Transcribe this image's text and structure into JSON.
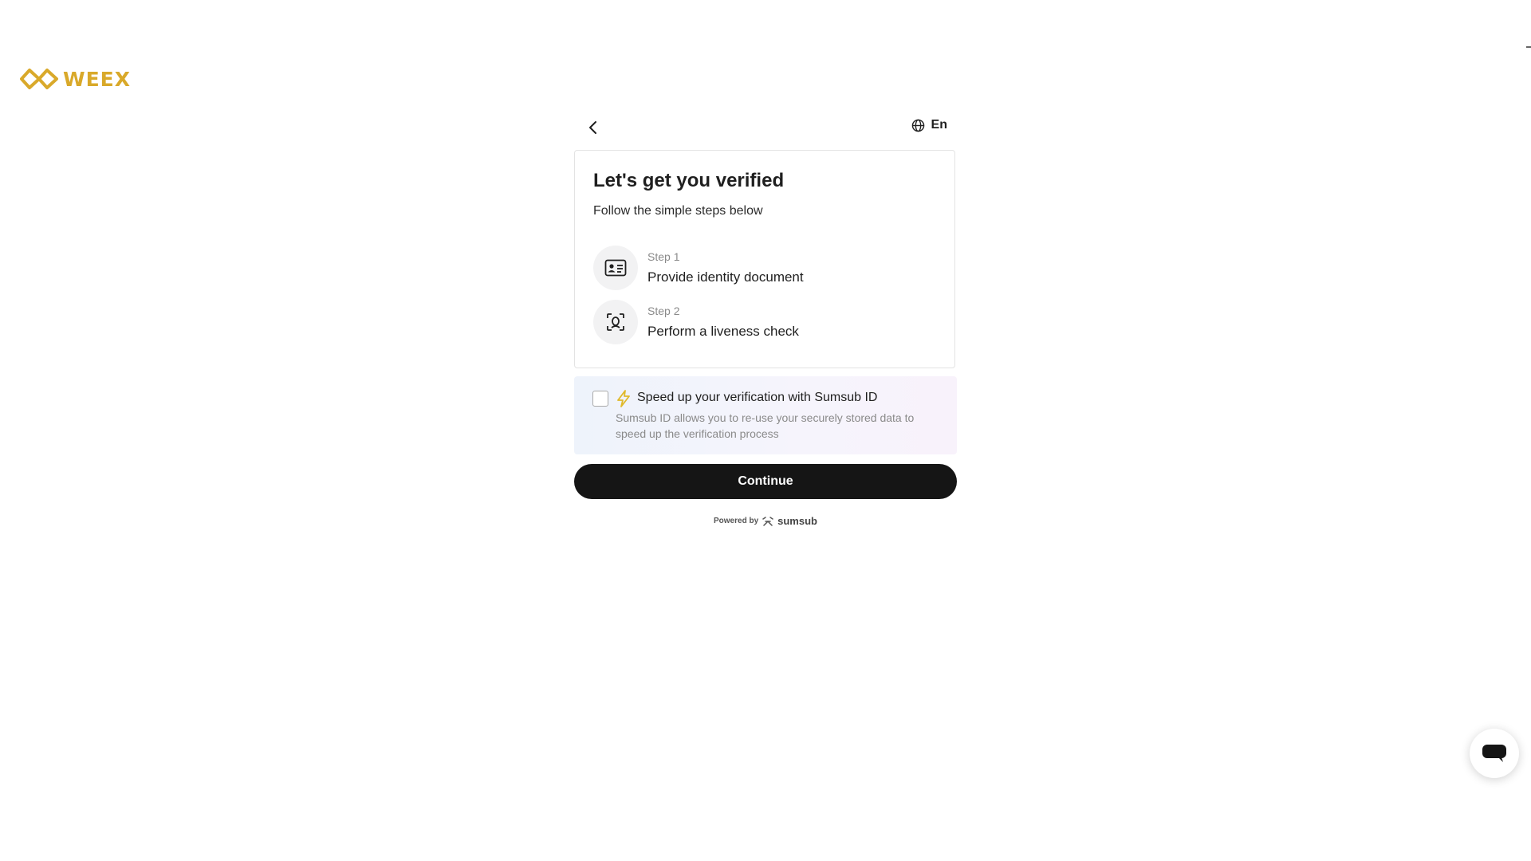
{
  "brand": {
    "logo_text": "WEEX",
    "logo_color": "#d9a92a"
  },
  "top_bar": {
    "back_icon": "chevron-left-icon",
    "language_icon": "globe-icon",
    "language_label": "En"
  },
  "card": {
    "title": "Let's get you verified",
    "subtitle": "Follow the simple steps below",
    "steps": [
      {
        "label": "Step 1",
        "text": "Provide identity document",
        "icon": "id-card-icon"
      },
      {
        "label": "Step 2",
        "text": "Perform a liveness check",
        "icon": "face-scan-icon"
      }
    ]
  },
  "sumsub_id": {
    "checked": false,
    "icon": "lightning-bolt-icon",
    "title": "Speed up your verification with Sumsub ID",
    "description": "Sumsub ID allows you to re-use your securely stored data to speed up the verification process",
    "bolt_color": "#e0b92a"
  },
  "actions": {
    "continue_label": "Continue",
    "button_color": "#151515"
  },
  "footer": {
    "powered_by": "Powered by",
    "provider": "sumsub"
  },
  "chat": {
    "icon": "chat-bubble-icon"
  }
}
